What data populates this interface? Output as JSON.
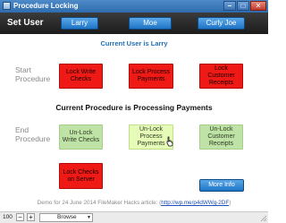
{
  "window": {
    "title": "Procedure Locking",
    "minimize": "–",
    "maximize": "□",
    "close": "✕",
    "icons": {
      "app": "app-window-icon",
      "cursor": "hand-pointer-icon",
      "grip": "resize-grip-icon"
    }
  },
  "userbar": {
    "label": "Set User",
    "users": [
      "Larry",
      "Moe",
      "Curly Joe"
    ]
  },
  "current_user_text": "Current User is Larry",
  "start": {
    "label_line1": "Start",
    "label_line2": "Procedure",
    "buttons": [
      "Lock Write Checks",
      "Lock Process Payments",
      "Lock Customer Receipts"
    ]
  },
  "current_procedure_text": "Current Procedure is Processing Payments",
  "end": {
    "label_line1": "End",
    "label_line2": "Procedure",
    "buttons": [
      "Un-Lock Write Checks",
      "Un-Lock Process Payments",
      "Un-Lock Customer Receipts"
    ],
    "server_button": "Lock Checks on Server"
  },
  "more_info_label": "More Info",
  "footer": {
    "demo_text": "Demo for 24 June 2014 FileMaker Hacks article: (",
    "link_text": "http://wp.me/p4dWWg-2DF",
    "demo_suffix": ")"
  },
  "statusbar": {
    "zoom": "100",
    "zoom_out": "−",
    "zoom_in": "+",
    "mode": "Browse",
    "mode_arrow": "▼"
  },
  "colors": {
    "accent_blue": "#1f74c6",
    "lock_red": "#ef1a16",
    "unlock_green": "#bfe3a6"
  }
}
